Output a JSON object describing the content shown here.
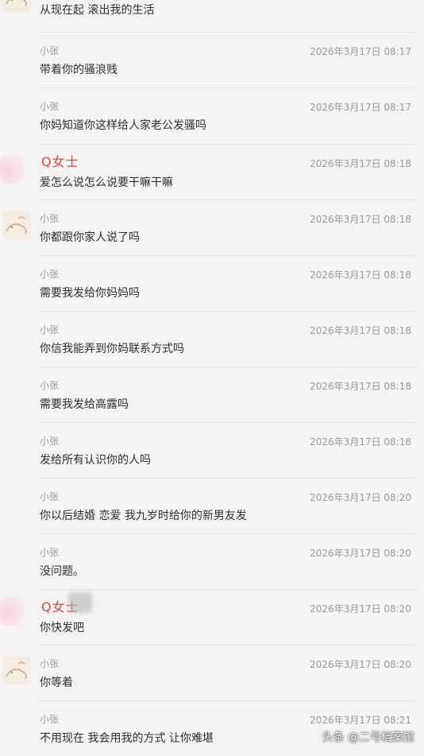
{
  "partial_first_message": {
    "content": "从现在起 滚出我的生活"
  },
  "messages": [
    {
      "sender": "小张",
      "timestamp": "2026年3月17日 08:17",
      "content": "带着你的骚浪贱"
    },
    {
      "sender": "小张",
      "timestamp": "2026年3月17日 08:17",
      "content": "你妈知道你这样给人家老公发骚吗"
    },
    {
      "sender": "Q女士",
      "timestamp": "2026年3月17日 08:18",
      "content": "爱怎么说怎么说要干嘛干嘛"
    },
    {
      "sender": "小张",
      "timestamp": "2026年3月17日 08:18",
      "content": "你都跟你家人说了吗"
    },
    {
      "sender": "小张",
      "timestamp": "2026年3月17日 08:18",
      "content": "需要我发给你妈妈吗"
    },
    {
      "sender": "小张",
      "timestamp": "2026年3月17日 08:18",
      "content": "你信我能弄到你妈联系方式吗"
    },
    {
      "sender": "小张",
      "timestamp": "2026年3月17日 08:18",
      "content": "需要我发给高露吗"
    },
    {
      "sender": "小张",
      "timestamp": "2026年3月17日 08:18",
      "content": "发给所有认识你的人吗"
    },
    {
      "sender": "小张",
      "timestamp": "2026年3月17日 08:20",
      "content": "你以后结婚 恋爱 我九岁时给你的新男友发"
    },
    {
      "sender": "小张",
      "timestamp": "2026年3月17日 08:20",
      "content": "没问题。"
    },
    {
      "sender": "Q女士",
      "timestamp": "2026年3月17日 08:20",
      "content": "你快发吧"
    },
    {
      "sender": "小张",
      "timestamp": "2026年3月17日 08:20",
      "content": "你等着"
    },
    {
      "sender": "小张",
      "timestamp": "2026年3月17日 08:21",
      "content": "不用现在 我会用我的方式 让你难堪"
    }
  ],
  "watermark": "头条 @二号档案馆",
  "colors": {
    "background": "#f4f4f4",
    "sender_female": "#e0443a",
    "meta_gray": "#9a9a9a",
    "text": "#2e2e2e"
  }
}
